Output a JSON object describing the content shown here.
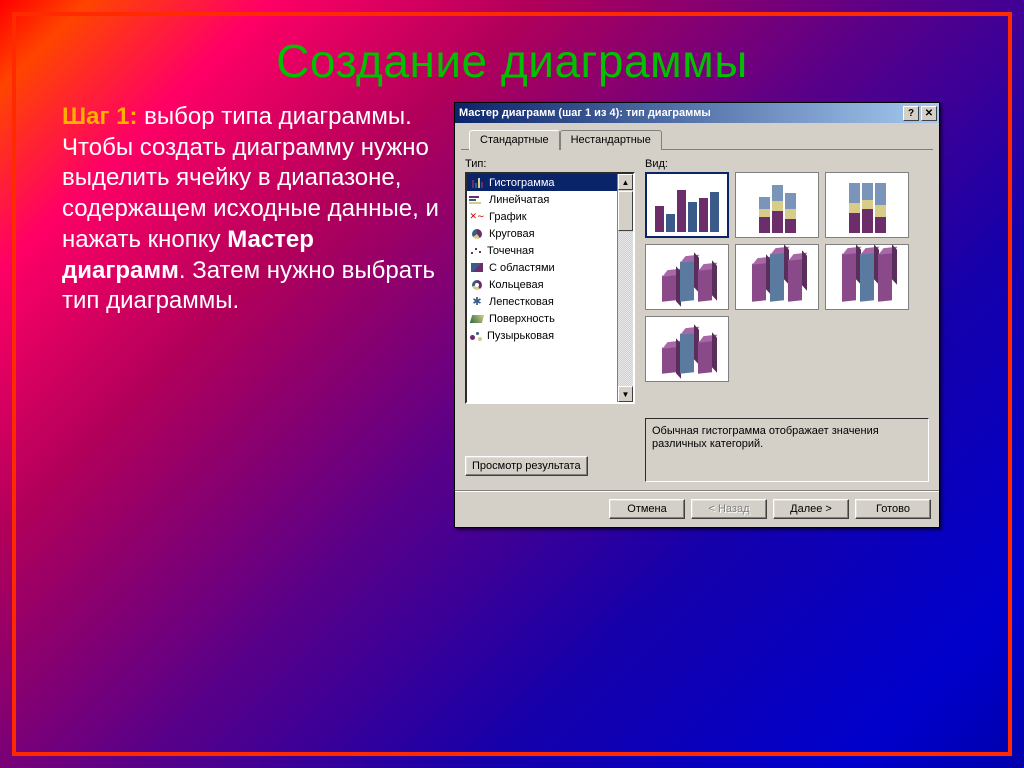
{
  "slide": {
    "title": "Создание диаграммы",
    "step_label": "Шаг 1:",
    "text1": " выбор типа диаграммы. Чтобы создать диаграмму нужно выделить ячейку в диапазоне, содержащем исходные данные, и нажать кнопку ",
    "bold": "Мастер диаграмм",
    "text2": ". Затем нужно выбрать тип диаграммы."
  },
  "dialog": {
    "title": "Мастер диаграмм (шаг 1 из 4): тип диаграммы",
    "help_btn": "?",
    "close_btn": "✕",
    "tabs": {
      "standard": "Стандартные",
      "custom": "Нестандартные"
    },
    "labels": {
      "type": "Тип:",
      "subtype": "Вид:"
    },
    "types": [
      {
        "label": "Гистограмма"
      },
      {
        "label": "Линейчатая"
      },
      {
        "label": "График"
      },
      {
        "label": "Круговая"
      },
      {
        "label": "Точечная"
      },
      {
        "label": "С областями"
      },
      {
        "label": "Кольцевая"
      },
      {
        "label": "Лепестковая"
      },
      {
        "label": "Поверхность"
      },
      {
        "label": "Пузырьковая"
      }
    ],
    "description": "Обычная гистограмма отображает значения различных категорий.",
    "preview_button": "Просмотр результата",
    "buttons": {
      "cancel": "Отмена",
      "back": "< Назад",
      "next": "Далее >",
      "finish": "Готово"
    }
  }
}
